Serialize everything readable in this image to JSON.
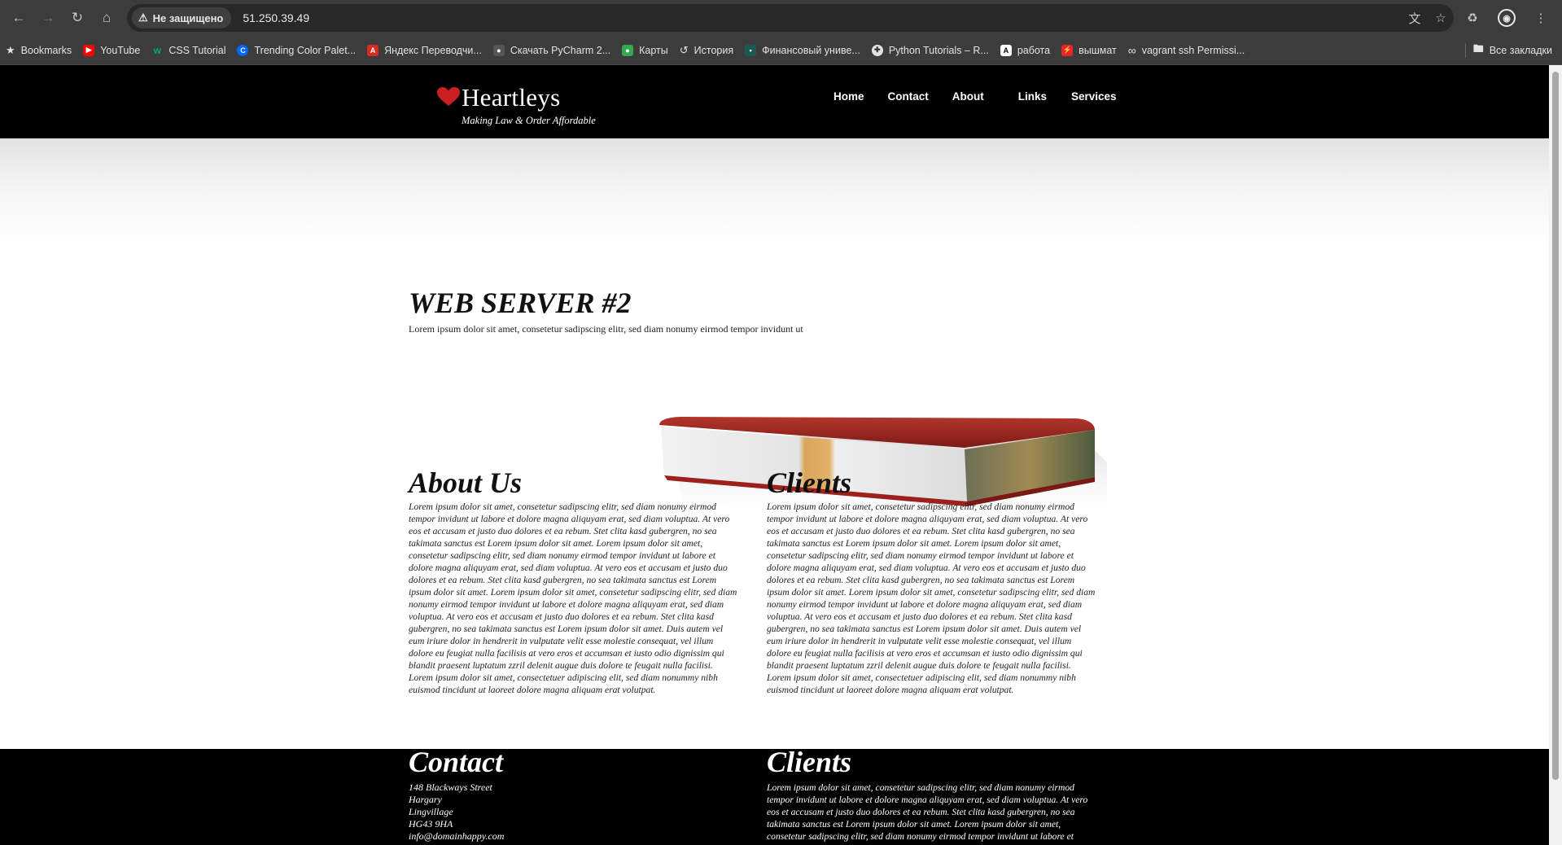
{
  "browser": {
    "security_label": "Не защищено",
    "url": "51.250.39.49",
    "bookmarks": [
      {
        "label": "Bookmarks",
        "icon": "star-icon"
      },
      {
        "label": "YouTube",
        "icon": "youtube-icon"
      },
      {
        "label": "CSS Tutorial",
        "icon": "w3schools-icon"
      },
      {
        "label": "Trending Color Palet...",
        "icon": "coolors-icon"
      },
      {
        "label": "Яндекс Переводчи...",
        "icon": "yandex-translate-icon"
      },
      {
        "label": "Скачать PyCharm 2...",
        "icon": "pycharm-icon"
      },
      {
        "label": "Карты",
        "icon": "maps-icon"
      },
      {
        "label": "История",
        "icon": "history-icon"
      },
      {
        "label": "Финансовый униве...",
        "icon": "university-icon"
      },
      {
        "label": "Python Tutorials – R...",
        "icon": "python-icon"
      },
      {
        "label": "работа",
        "icon": "letter-a-icon"
      },
      {
        "label": "вышмат",
        "icon": "lightning-icon"
      },
      {
        "label": "vagrant ssh Permissi...",
        "icon": "infinity-icon"
      }
    ],
    "all_bookmarks_label": "Все закладки"
  },
  "site": {
    "logo_name": "Heartleys",
    "logo_tagline": "Making Law & Order Affordable",
    "nav": [
      "Home",
      "Contact",
      "About",
      "Links",
      "Services"
    ],
    "hero_title": "WEB SERVER #2",
    "hero_subtitle": "Lorem ipsum dolor sit amet, consetetur sadipscing elitr, sed diam nonumy eirmod tempor invidunt ut",
    "about_title": "About Us",
    "about_body": "Lorem ipsum dolor sit amet, consetetur sadipscing elitr, sed diam nonumy eirmod tempor invidunt ut labore et dolore magna aliquyam erat, sed diam voluptua. At vero eos et accusam et justo duo dolores et ea rebum. Stet clita kasd gubergren, no sea takimata sanctus est Lorem ipsum dolor sit amet. Lorem ipsum dolor sit amet, consetetur sadipscing elitr, sed diam nonumy eirmod tempor invidunt ut labore et dolore magna aliquyam erat, sed diam voluptua. At vero eos et accusam et justo duo dolores et ea rebum. Stet clita kasd gubergren, no sea takimata sanctus est Lorem ipsum dolor sit amet. Lorem ipsum dolor sit amet, consetetur sadipscing elitr, sed diam nonumy eirmod tempor invidunt ut labore et dolore magna aliquyam erat, sed diam voluptua. At vero eos et accusam et justo duo dolores et ea rebum. Stet clita kasd gubergren, no sea takimata sanctus est Lorem ipsum dolor sit amet. Duis autem vel eum iriure dolor in hendrerit in vulputate velit esse molestie consequat, vel illum dolore eu feugiat nulla facilisis at vero eros et accumsan et iusto odio dignissim qui blandit praesent luptatum zzril delenit augue duis dolore te feugait nulla facilisi. Lorem ipsum dolor sit amet, consectetuer adipiscing elit, sed diam nonummy nibh euismod tincidunt ut laoreet dolore magna aliquam erat volutpat.",
    "clients_title": "Clients",
    "clients_body": "Lorem ipsum dolor sit amet, consetetur sadipscing elitr, sed diam nonumy eirmod tempor invidunt ut labore et dolore magna aliquyam erat, sed diam voluptua. At vero eos et accusam et justo duo dolores et ea rebum. Stet clita kasd gubergren, no sea takimata sanctus est Lorem ipsum dolor sit amet. Lorem ipsum dolor sit amet, consetetur sadipscing elitr, sed diam nonumy eirmod tempor invidunt ut labore et dolore magna aliquyam erat, sed diam voluptua. At vero eos et accusam et justo duo dolores et ea rebum. Stet clita kasd gubergren, no sea takimata sanctus est Lorem ipsum dolor sit amet. Lorem ipsum dolor sit amet, consetetur sadipscing elitr, sed diam nonumy eirmod tempor invidunt ut labore et dolore magna aliquyam erat, sed diam voluptua. At vero eos et accusam et justo duo dolores et ea rebum. Stet clita kasd gubergren, no sea takimata sanctus est Lorem ipsum dolor sit amet. Duis autem vel eum iriure dolor in hendrerit in vulputate velit esse molestie consequat, vel illum dolore eu feugiat nulla facilisis at vero eros et accumsan et iusto odio dignissim qui blandit praesent luptatum zzril delenit augue duis dolore te feugait nulla facilisi. Lorem ipsum dolor sit amet, consectetuer adipiscing elit, sed diam nonummy nibh euismod tincidunt ut laoreet dolore magna aliquam erat volutpat.",
    "footer_contact_title": "Contact",
    "footer_address": [
      "148 Blackways Street",
      "Hargary",
      "Lingvillage",
      "HG43 9HA",
      "info@domainhappy.com"
    ],
    "footer_clients_title": "Clients",
    "footer_clients_body": "Lorem ipsum dolor sit amet, consetetur sadipscing elitr, sed diam nonumy eirmod tempor invidunt ut labore et dolore magna aliquyam erat, sed diam voluptua. At vero eos et accusam et justo duo dolores et ea rebum. Stet clita kasd gubergren, no sea takimata sanctus est Lorem ipsum dolor sit amet. Lorem ipsum dolor sit amet, consetetur sadipscing elitr, sed diam nonumy eirmod tempor invidunt ut labore et",
    "accent_color": "#cc1f24"
  }
}
